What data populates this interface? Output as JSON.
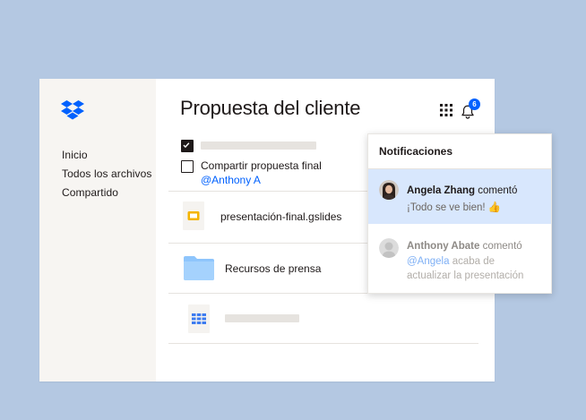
{
  "sidebar": {
    "items": [
      {
        "label": "Inicio"
      },
      {
        "label": "Todos los archivos"
      },
      {
        "label": "Compartido"
      }
    ]
  },
  "header": {
    "title": "Propuesta del cliente",
    "notification_count": "6"
  },
  "tasks": {
    "task_text": "Compartir propuesta final",
    "mention": "@Anthony A"
  },
  "files": [
    {
      "name": "presentación-final.gslides",
      "icon": "google-slides-icon"
    },
    {
      "name": "Recursos de prensa",
      "icon": "folder-icon"
    },
    {
      "name": "",
      "icon": "spreadsheet-icon"
    }
  ],
  "notifications": {
    "title": "Notificaciones",
    "items": [
      {
        "user": "Angela Zhang",
        "action": "comentó",
        "message": "¡Todo se ve bien!",
        "emoji": "👍"
      },
      {
        "user": "Anthony Abate",
        "action": "comentó",
        "mention": "@Angela",
        "message_rest": "acaba de",
        "message_line2": "actualizar la presentación"
      }
    ]
  },
  "colors": {
    "background": "#b4c8e2",
    "accent": "#0061fe",
    "sidebar": "#f7f5f2",
    "active_notification": "#d8e7fd"
  }
}
